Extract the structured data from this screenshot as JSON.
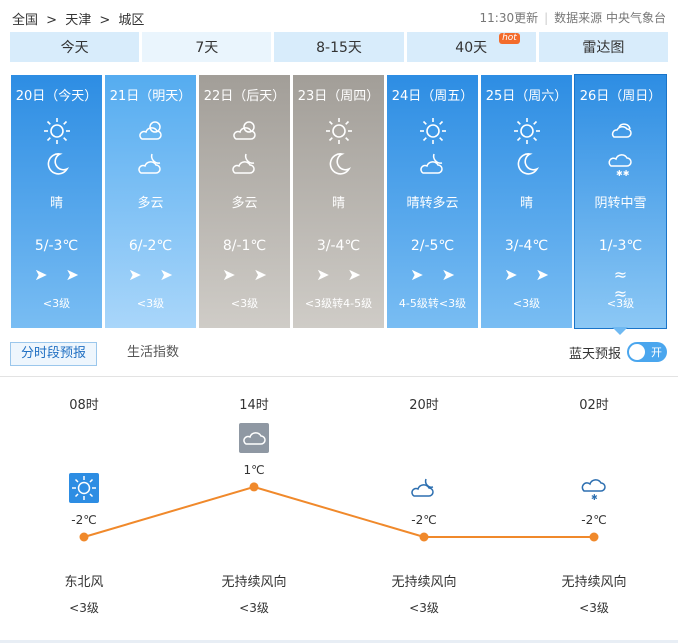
{
  "breadcrumb": [
    "全国",
    ">",
    "天津",
    ">",
    "城区"
  ],
  "update_time": "11:30更新",
  "source": "数据来源 中央气象台",
  "tabs": [
    {
      "label": "今天"
    },
    {
      "label": "7天"
    },
    {
      "label": "8-15天"
    },
    {
      "label": "40天",
      "badge": "hot"
    },
    {
      "label": "雷达图"
    }
  ],
  "days": [
    {
      "date": "20日（今天）",
      "desc": "晴",
      "temp": "5/-3℃",
      "winds": "➤➤",
      "level": "<3级",
      "icon_day": "sun-icon",
      "icon_night": "moon-icon"
    },
    {
      "date": "21日（明天）",
      "desc": "多云",
      "temp": "6/-2℃",
      "winds": "➤➤",
      "level": "<3级",
      "icon_day": "partly-cloudy-icon",
      "icon_night": "cloudy-night-icon"
    },
    {
      "date": "22日（后天）",
      "desc": "多云",
      "temp": "8/-1℃",
      "winds": "➤➤",
      "level": "<3级",
      "icon_day": "partly-cloudy-icon",
      "icon_night": "cloudy-night-icon"
    },
    {
      "date": "23日（周四）",
      "desc": "晴",
      "temp": "3/-4℃",
      "winds": "➤➤",
      "level": "<3级转4-5级",
      "icon_day": "sun-icon",
      "icon_night": "moon-icon"
    },
    {
      "date": "24日（周五）",
      "desc": "晴转多云",
      "temp": "2/-5℃",
      "winds": "➤➤",
      "level": "4-5级转<3级",
      "icon_day": "sun-icon",
      "icon_night": "cloudy-night-icon"
    },
    {
      "date": "25日（周六）",
      "desc": "晴",
      "temp": "3/-4℃",
      "winds": "➤➤",
      "level": "<3级",
      "icon_day": "sun-icon",
      "icon_night": "moon-icon"
    },
    {
      "date": "26日（周日）",
      "desc": "阴转中雪",
      "temp": "1/-3℃",
      "winds": "≈ ≈",
      "level": "<3级",
      "icon_day": "overcast-icon",
      "icon_night": "snow-icon"
    }
  ],
  "subtabs": [
    "分时段预报",
    "生活指数"
  ],
  "toggle": {
    "label": "蓝天预报",
    "state": "开"
  },
  "hourly": [
    {
      "time": "08时",
      "temp": "-2℃",
      "wind": "东北风",
      "level": "<3级",
      "icon": "sun-icon"
    },
    {
      "time": "14时",
      "temp": "1℃",
      "wind": "无持续风向",
      "level": "<3级",
      "icon": "cloud-icon"
    },
    {
      "time": "20时",
      "temp": "-2℃",
      "wind": "无持续风向",
      "level": "<3级",
      "icon": "cloudy-night-icon"
    },
    {
      "time": "02时",
      "temp": "-2℃",
      "wind": "无持续风向",
      "level": "<3级",
      "icon": "snow-icon"
    }
  ],
  "colors": {
    "accent": "#2d8de3",
    "line": "#f0892b",
    "gray_day": "#a29e98"
  }
}
